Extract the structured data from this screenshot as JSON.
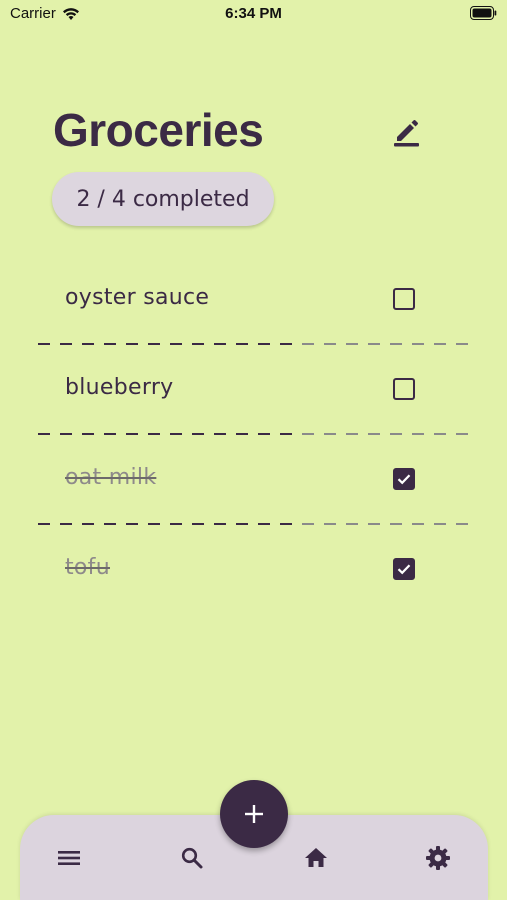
{
  "status_bar": {
    "carrier": "Carrier",
    "time": "6:34 PM"
  },
  "list": {
    "title": "Groceries",
    "progress": "2 / 4 completed",
    "items": [
      {
        "label": "oyster sauce",
        "checked": false
      },
      {
        "label": "blueberry",
        "checked": false
      },
      {
        "label": "oat milk",
        "checked": true
      },
      {
        "label": "tofu",
        "checked": true
      }
    ]
  },
  "icons": {
    "edit": "pencil-icon",
    "menu": "menu-icon",
    "search": "search-icon",
    "home": "home-icon",
    "settings": "gear-icon",
    "add": "plus-icon"
  },
  "colors": {
    "background": "#e2f2aa",
    "accent": "#3b2a45",
    "nav_background": "#dcd4de",
    "chip_background": "#ddd6df",
    "done_text": "#8e8a8a"
  }
}
